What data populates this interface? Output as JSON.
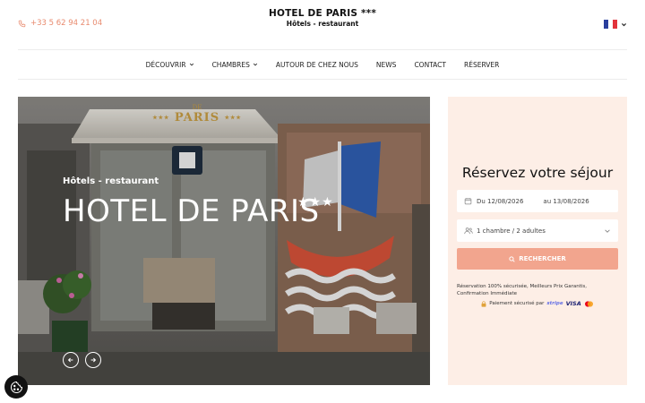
{
  "header": {
    "phone": "+33 5 62 94 21 04",
    "brand_title": "HOTEL DE PARIS ***",
    "brand_subtitle": "Hôtels - restaurant",
    "language_flag": "fr-flag-icon"
  },
  "nav": {
    "items": [
      {
        "label": "DÉCOUVRIR",
        "has_dropdown": true
      },
      {
        "label": "CHAMBRES",
        "has_dropdown": true
      },
      {
        "label": "AUTOUR DE CHEZ NOUS",
        "has_dropdown": false
      },
      {
        "label": "NEWS",
        "has_dropdown": false
      },
      {
        "label": "CONTACT",
        "has_dropdown": false
      },
      {
        "label": "RÉSERVER",
        "has_dropdown": false
      }
    ]
  },
  "hero": {
    "subtitle": "Hôtels - restaurant",
    "title": "HOTEL DE PARIS",
    "stars": "★★★",
    "sign_top": "DE",
    "sign_name": "PARIS",
    "sign_stars": "★★★",
    "prev_icon": "arrow-left-icon",
    "next_icon": "arrow-right-icon"
  },
  "booking": {
    "title": "Réservez votre séjour",
    "date_from": "Du 12/08/2026",
    "date_to": "au 13/08/2026",
    "guests": "1 chambre / 2 adultes",
    "search_label": "RECHERCHER",
    "secure_note": "Réservation 100% sécurisée, Meilleurs Prix Garantis, Confirmation Immédiate",
    "payment_label": "Paiement sécurisé par",
    "stripe": "stripe",
    "visa": "VISA"
  },
  "colors": {
    "accent": "#f2a58e",
    "phone": "#e88a6e",
    "panel_bg": "#fdeee6"
  }
}
